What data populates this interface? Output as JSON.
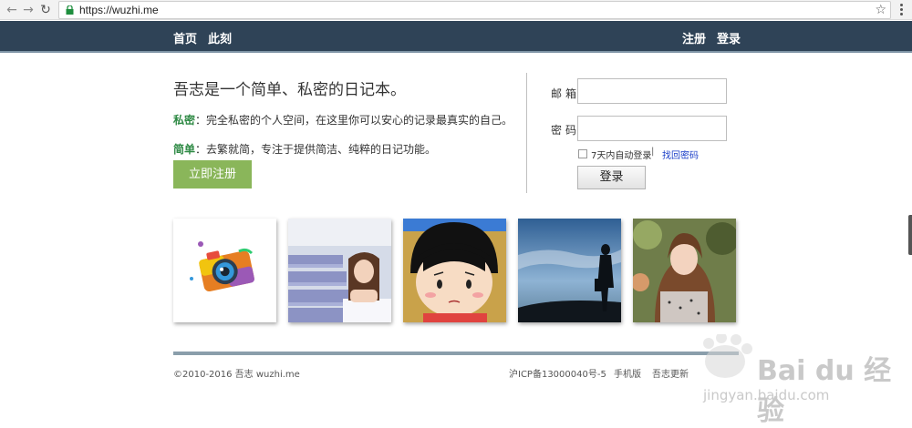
{
  "browser": {
    "url": "https://wuzhi.me",
    "back_icon": "arrow-left",
    "forward_icon": "arrow-right",
    "reload_icon": "reload",
    "star_icon": "star",
    "back_glyph": "←",
    "forward_glyph": "→",
    "reload_glyph": "↻",
    "star_glyph": "☆"
  },
  "header": {
    "nav": [
      "首页",
      "此刻"
    ],
    "register": "注册",
    "login": "登录",
    "bg_color": "#2f4357"
  },
  "hero": {
    "tagline": "吾志是一个简单、私密的日记本。",
    "features": [
      {
        "title": "私密",
        "text": "：完全私密的个人空间，在这里你可以安心的记录最真实的自己。"
      },
      {
        "title": "简单",
        "text": "：去繁就简，专注于提供简洁、纯粹的日记功能。"
      }
    ],
    "register_button": "立即注册",
    "accent_color": "#8ab65a"
  },
  "login": {
    "email_label": "邮箱",
    "email_value": "",
    "password_label": "密码",
    "password_value": "",
    "remember_label": "7天内自动登录",
    "separator": "|",
    "forgot_link": "找回密码",
    "submit": "登录"
  },
  "gallery": [
    "camera-illustration",
    "girl-in-classroom",
    "cartoon-girl",
    "silhouette-at-dusk",
    "girl-portrait"
  ],
  "footer": {
    "copyright": "©2010-2016 吾志 wuzhi.me",
    "icp": "沪ICP备13000040号-5",
    "links": [
      "手机版",
      "吾志更新"
    ]
  },
  "watermark": {
    "brand": "Bai du 经验",
    "sub": "jingyan.baidu.com"
  }
}
